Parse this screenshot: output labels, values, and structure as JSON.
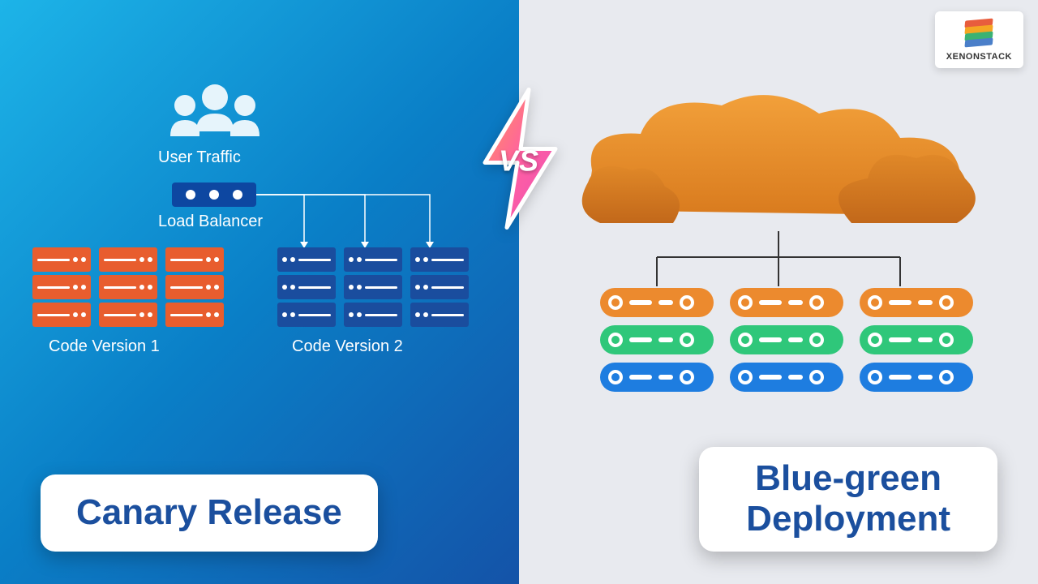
{
  "brand": {
    "name": "XENONSTACK"
  },
  "vs": "VS",
  "left": {
    "title": "Canary Release",
    "userTraffic": "User Traffic",
    "loadBalancer": "Load Balancer",
    "codeVersion1": "Code Version 1",
    "codeVersion2": "Code Version 2"
  },
  "right": {
    "title": "Blue-green\nDeployment"
  },
  "colors": {
    "orange": "#e85d2e",
    "blue": "#1a4d9e",
    "pillOrange": "#ec8a2e",
    "pillGreen": "#2fc77a",
    "pillBlue": "#1e7de0",
    "titleText": "#1b4f9e"
  }
}
